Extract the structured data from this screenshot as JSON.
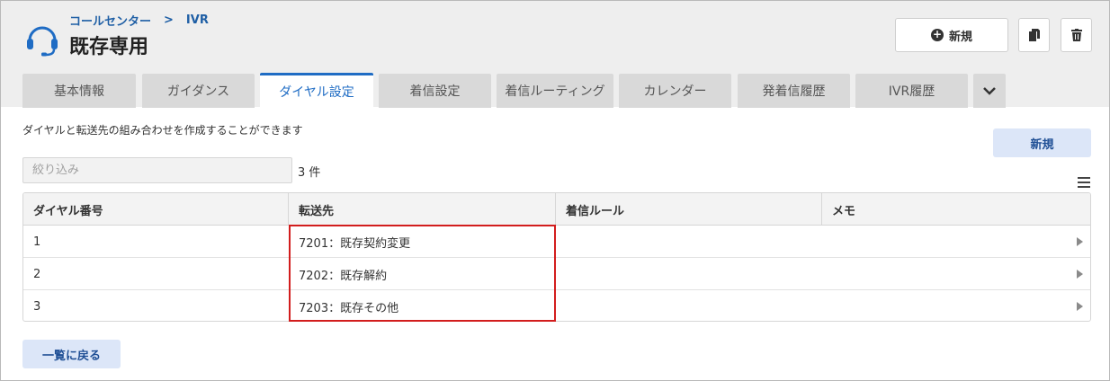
{
  "header": {
    "breadcrumb": [
      "コールセンター",
      "IVR"
    ],
    "breadcrumb_separator": ">",
    "title": "既存専用",
    "new_button_label": "新規",
    "icons": {
      "logo": "headset-icon",
      "new": "plus-circle-icon",
      "copy": "copy-icon",
      "delete": "trash-icon"
    }
  },
  "tabs": [
    {
      "label": "基本情報",
      "active": false
    },
    {
      "label": "ガイダンス",
      "active": false
    },
    {
      "label": "ダイヤル設定",
      "active": true
    },
    {
      "label": "着信設定",
      "active": false
    },
    {
      "label": "着信ルーティング",
      "active": false
    },
    {
      "label": "カレンダー",
      "active": false
    },
    {
      "label": "発着信履歴",
      "active": false
    },
    {
      "label": "IVR履歴",
      "active": false
    }
  ],
  "tabs_more_icon": "chevron-down-icon",
  "content": {
    "description": "ダイヤルと転送先の組み合わせを作成することができます",
    "new_button_label": "新規",
    "filter_placeholder": "絞り込み",
    "count_text": "3 件",
    "columns_menu_icon": "hamburger-menu-icon"
  },
  "table": {
    "columns": [
      "ダイヤル番号",
      "転送先",
      "着信ルール",
      "メモ"
    ],
    "rows": [
      {
        "dial": "1",
        "destination": "7201：既存契約変更",
        "rule": "",
        "memo": ""
      },
      {
        "dial": "2",
        "destination": "7202：既存解約",
        "rule": "",
        "memo": ""
      },
      {
        "dial": "3",
        "destination": "7203：既存その他",
        "rule": "",
        "memo": ""
      }
    ]
  },
  "footer": {
    "back_button_label": "一覧に戻る"
  },
  "colors": {
    "accent": "#1f6cc4",
    "highlight_border": "#d21d1d",
    "button_blue_bg": "#dce6f8",
    "header_bg": "#eeeeee"
  }
}
